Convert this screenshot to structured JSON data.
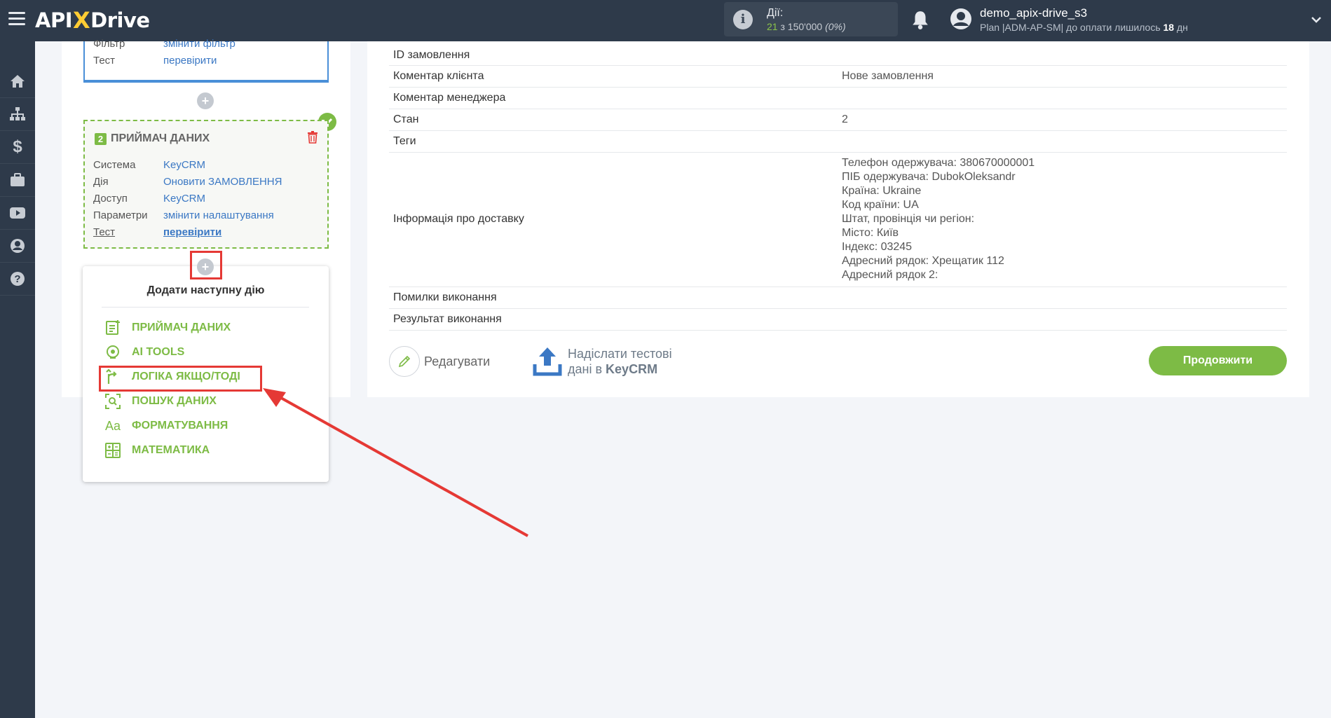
{
  "header": {
    "logo_left": "API",
    "logo_x": "X",
    "logo_right": "Drive",
    "actions_label": "Дії:",
    "actions_used": "21",
    "actions_of": "з",
    "actions_total": "150'000",
    "actions_percent": "(0%)",
    "user_name": "demo_apix-drive_s3",
    "plan_text": "Plan |ADM-AP-SM| до оплати лишилось",
    "plan_days": "18",
    "plan_days_unit": "дн"
  },
  "sidebar": {
    "items": [
      "home-icon",
      "sitemap-icon",
      "dollar-icon",
      "briefcase-icon",
      "youtube-icon",
      "user-icon",
      "help-icon"
    ]
  },
  "block1": {
    "rows": [
      {
        "label": "Фільтр",
        "value": "змінити фільтр"
      },
      {
        "label": "Тест",
        "value": "перевірити"
      }
    ]
  },
  "block2": {
    "number": "2",
    "title": "ПРИЙМАЧ ДАНИХ",
    "rows": [
      {
        "label": "Система",
        "value": "KeyCRM"
      },
      {
        "label": "Дія",
        "value": "Оновити ЗАМОВЛЕННЯ"
      },
      {
        "label": "Доступ",
        "value": "KeyCRM"
      },
      {
        "label": "Параметри",
        "value": "змінити налаштування"
      },
      {
        "label": "Тест",
        "value": "перевірити"
      }
    ]
  },
  "add_menu": {
    "plus": "+",
    "title": "Додати наступну дію",
    "items": [
      {
        "label": "ПРИЙМАЧ ДАНИХ",
        "icon": "receiver-icon"
      },
      {
        "label": "AI TOOLS",
        "icon": "ai-tools-icon"
      },
      {
        "label": "ЛОГІКА ЯКЩО/ТОДІ",
        "icon": "logic-icon"
      },
      {
        "label": "ПОШУК ДАНИХ",
        "icon": "search-data-icon"
      },
      {
        "label": "ФОРМАТУВАННЯ",
        "icon": "format-icon",
        "glyph": "Aa"
      },
      {
        "label": "МАТЕМАТИКА",
        "icon": "math-icon"
      }
    ]
  },
  "table": {
    "rows": [
      {
        "key": "ID замовлення",
        "value": ""
      },
      {
        "key": "Коментар клієнта",
        "value": "Нове замовлення"
      },
      {
        "key": "Коментар менеджера",
        "value": ""
      },
      {
        "key": "Стан",
        "value": "2"
      },
      {
        "key": "Теги",
        "value": ""
      },
      {
        "key": "Інформація про доставку",
        "value": ""
      },
      {
        "key": "Помилки виконання",
        "value": ""
      },
      {
        "key": "Результат виконання",
        "value": ""
      }
    ],
    "delivery_lines": [
      "Телефон одержувача: 380670000001",
      "ПІБ одержувача: DubokOleksandr",
      "Країна: Ukraine",
      "Код країни: UA",
      "Штат, провінція чи регіон:",
      "Місто: Київ",
      "Індекс: 03245",
      "Адресний рядок: Хрещатик 112",
      "Адресний рядок 2:"
    ]
  },
  "buttons": {
    "edit": "Редагувати",
    "send_line1": "Надіслати тестові",
    "send_line2_prefix": "дані в",
    "send_line2_system": "KeyCRM",
    "continue": "Продовжити"
  },
  "colors": {
    "topbar": "#2e3a4a",
    "accent_green": "#7dbb45",
    "link_blue": "#3b78c4",
    "highlight_red": "#e53935"
  }
}
